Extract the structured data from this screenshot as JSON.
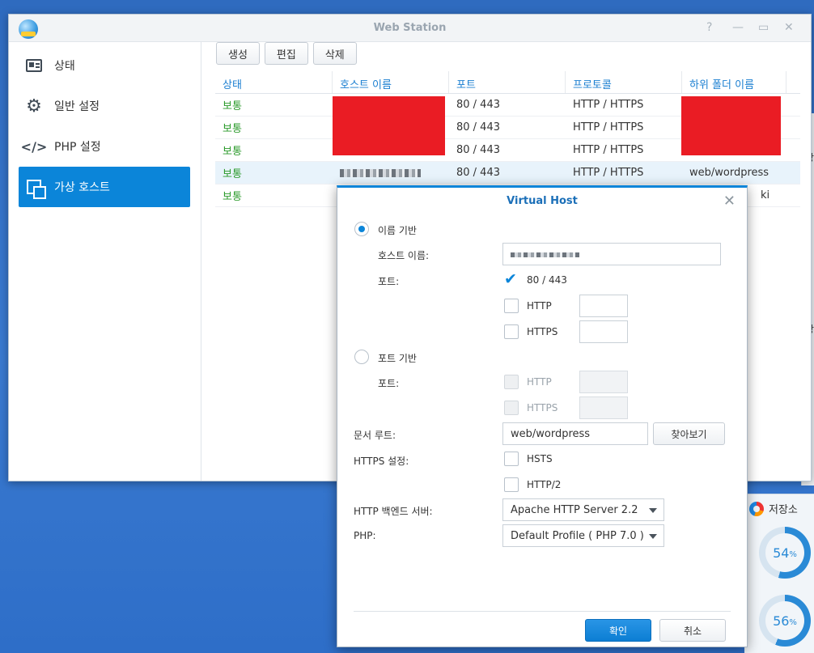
{
  "window": {
    "title": "Web Station",
    "help": "?",
    "minimize": "—",
    "maximize": "▭",
    "close": "✕"
  },
  "sidebar": {
    "items": [
      {
        "label": "상태"
      },
      {
        "label": "일반 설정"
      },
      {
        "label": "PHP 설정"
      },
      {
        "label": "가상 호스트"
      }
    ]
  },
  "toolbar": {
    "create": "생성",
    "edit": "편집",
    "delete": "삭제"
  },
  "table": {
    "columns": [
      "상태",
      "호스트 이름",
      "포트",
      "프로토콜",
      "하위 폴더 이름"
    ],
    "rows": [
      {
        "status": "보통",
        "host": "",
        "port": "80 / 443",
        "protocol": "HTTP / HTTPS",
        "folder": ""
      },
      {
        "status": "보통",
        "host": "",
        "port": "80 / 443",
        "protocol": "HTTP / HTTPS",
        "folder": ""
      },
      {
        "status": "보통",
        "host": "",
        "port": "80 / 443",
        "protocol": "HTTP / HTTPS",
        "folder": ""
      },
      {
        "status": "보통",
        "host": "",
        "port": "80 / 443",
        "protocol": "HTTP / HTTPS",
        "folder": "web/wordpress"
      },
      {
        "status": "보통",
        "host": "",
        "port": "",
        "protocol": "",
        "folder": "ki"
      }
    ]
  },
  "dialog": {
    "title": "Virtual Host",
    "close": "✕",
    "name_based": "이름 기반",
    "hostname_label": "호스트 이름:",
    "port_label": "포트:",
    "port_default": "80 / 443",
    "http": "HTTP",
    "https": "HTTPS",
    "port_based": "포트 기반",
    "port_label2": "포트:",
    "http2": "HTTP",
    "https2": "HTTPS",
    "docroot_label": "문서 루트:",
    "docroot_value": "web/wordpress",
    "browse": "찾아보기",
    "https_settings_label": "HTTPS 설정:",
    "hsts": "HSTS",
    "http2_option": "HTTP/2",
    "backend_label": "HTTP 백엔드 서버:",
    "backend_value": "Apache HTTP Server 2.2",
    "php_label": "PHP:",
    "php_value": "Default Profile ( PHP 7.0 )",
    "ok": "확인",
    "cancel": "취소"
  },
  "desktop": {
    "storage_label": "저장소",
    "gauge1": {
      "value": "54",
      "unit": "%",
      "fraction": 0.54
    },
    "gauge2": {
      "value": "56",
      "unit": "%",
      "fraction": 0.56
    },
    "side_char1": "상",
    "side_char2": "상",
    "colors": {
      "accent": "#0b85d9",
      "ok": "#2a9a2a",
      "redaction": "#ea1c24",
      "gauge": "#2a8ad6",
      "gauge_track": "#d6e4f0"
    }
  }
}
